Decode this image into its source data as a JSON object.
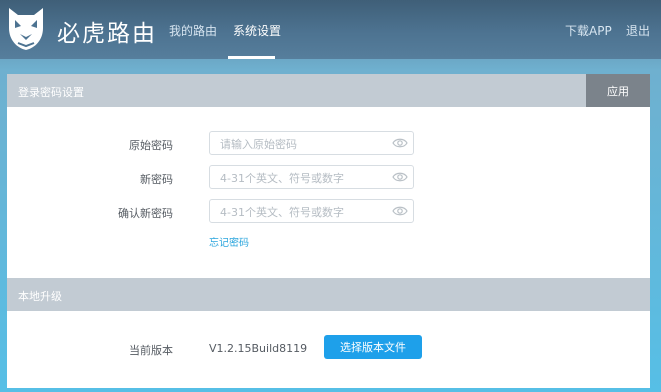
{
  "header": {
    "brand": "必虎路由",
    "logo_icon": "tiger-head-icon",
    "nav": [
      {
        "label": "我的路由",
        "active": false
      },
      {
        "label": "系统设置",
        "active": true
      }
    ],
    "download_app": "下载APP",
    "logout": "退出"
  },
  "password_section": {
    "title": "登录密码设置",
    "apply": "应用",
    "fields": [
      {
        "label": "原始密码",
        "placeholder": "请输入原始密码",
        "icon": "eye-icon"
      },
      {
        "label": "新密码",
        "placeholder": "4-31个英文、符号或数字",
        "icon": "eye-icon"
      },
      {
        "label": "确认新密码",
        "placeholder": "4-31个英文、符号或数字",
        "icon": "eye-icon"
      }
    ],
    "forgot_link": "忘记密码"
  },
  "upgrade_section": {
    "title": "本地升级",
    "current_version_label": "当前版本",
    "current_version": "V1.2.15Build8119",
    "select_file": "选择版本文件"
  },
  "colors": {
    "header": "#4d7391",
    "section_bar": "#c2cbd3",
    "apply_button": "#7b838b",
    "primary_button": "#1ea0ea",
    "link": "#2aa5dd"
  }
}
